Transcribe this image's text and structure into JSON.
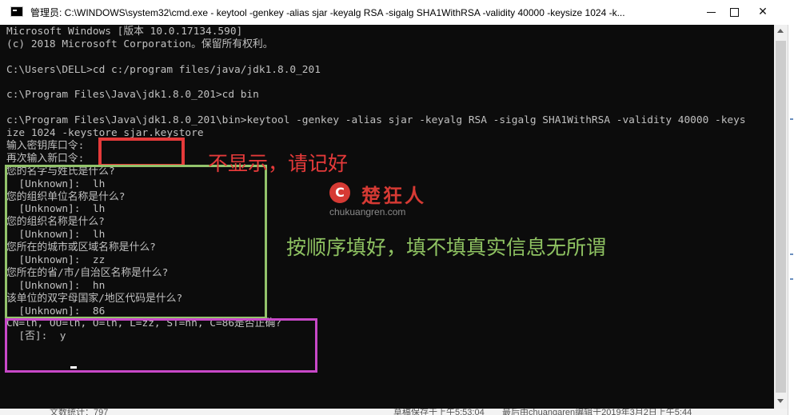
{
  "window": {
    "title": "管理员: C:\\WINDOWS\\system32\\cmd.exe - keytool  -genkey -alias sjar -keyalg RSA -sigalg SHA1WithRSA -validity 40000 -keysize 1024 -k...",
    "minimize_symbol": "—",
    "maximize_symbol": "□",
    "close_symbol": "✕"
  },
  "console": {
    "lines": [
      "Microsoft Windows [版本 10.0.17134.590]",
      "(c) 2018 Microsoft Corporation。保留所有权利。",
      "",
      "C:\\Users\\DELL>cd c:/program files/java/jdk1.8.0_201",
      "",
      "c:\\Program Files\\Java\\jdk1.8.0_201>cd bin",
      "",
      "c:\\Program Files\\Java\\jdk1.8.0_201\\bin>keytool -genkey -alias sjar -keyalg RSA -sigalg SHA1WithRSA -validity 40000 -keys",
      "ize 1024 -keystore sjar.keystore",
      "输入密钥库口令:",
      "再次输入新口令:",
      "您的名字与姓氏是什么?",
      "  [Unknown]:  lh",
      "您的组织单位名称是什么?",
      "  [Unknown]:  lh",
      "您的组织名称是什么?",
      "  [Unknown]:  lh",
      "您所在的城市或区域名称是什么?",
      "  [Unknown]:  zz",
      "您所在的省/市/自治区名称是什么?",
      "  [Unknown]:  hn",
      "该单位的双字母国家/地区代码是什么?",
      "  [Unknown]:  86",
      "CN=lh, OU=lh, O=lh, L=zz, ST=hn, C=86是否正确?",
      "  [否]:  y"
    ]
  },
  "annotations": {
    "password_note": "不显示，请记好",
    "fill_note": "按顺序填好，填不填真实信息无所谓"
  },
  "watermark": {
    "logo_glyph": "C",
    "name": "楚狂人",
    "url": "chukuangren.com"
  },
  "status_bar": {
    "word_count": "文数统计：797",
    "draft_saved": "草稿保存于上午5:53:04",
    "last_edit": "最后由chuangaren编辑于2019年3月2日上午5:44"
  },
  "colors": {
    "console_bg": "#0c0c0c",
    "console_text": "#c0c0c0",
    "red_annotation": "#e53a3a",
    "green_annotation": "#8fc362",
    "magenta_box": "#c848c8"
  }
}
